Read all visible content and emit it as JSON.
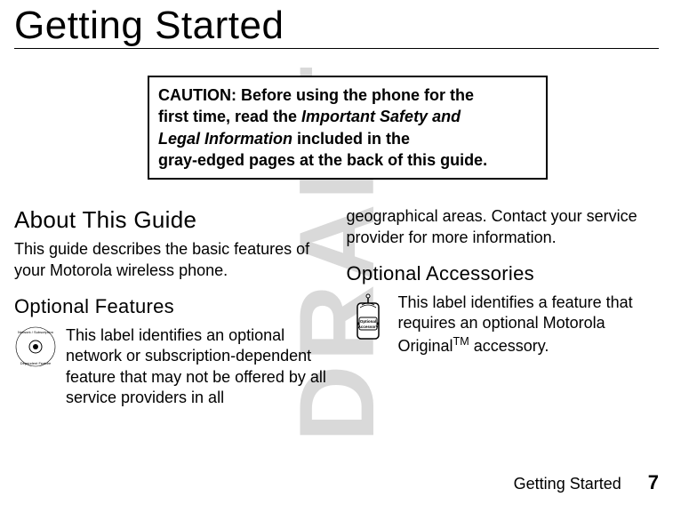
{
  "watermark": "DRAFT",
  "title": "Getting Started",
  "caution": {
    "prefix": "CAUTION:",
    "l1_rest": " Before using the phone for the",
    "l2_a": "first time, read the ",
    "l2_italic": "Important Safety and",
    "l3_italic": "Legal Information",
    "l3_rest": " included in the",
    "l4": "gray-edged pages at the back of this guide."
  },
  "left": {
    "h2": "About This Guide",
    "p1": "This guide describes the basic features of your Motorola wireless phone.",
    "h3": "Optional Features",
    "p2": "This label identifies an optional network or subscription-dependent feature that may not be offered by all service providers in all"
  },
  "right": {
    "cont": "geographical areas. Contact your service provider for more information.",
    "h3": "Optional Accessories",
    "p_a": "This label identifies a feature that requires an optional Motorola Original",
    "p_tm": "TM",
    "p_b": " accessory."
  },
  "footer": {
    "section": "Getting Started",
    "page": "7"
  },
  "icons": {
    "network_label_top": "Network / Subscription",
    "network_label_bottom": "Dependent Feature",
    "accessory_label1": "Optional",
    "accessory_label2": "Accessory"
  }
}
